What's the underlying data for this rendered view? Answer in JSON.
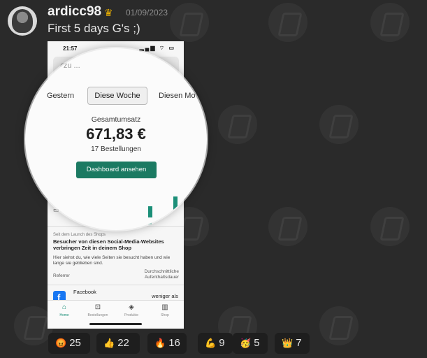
{
  "post": {
    "username": "ardicc98",
    "badge_icon": "crown-icon",
    "date": "01/09/2023",
    "message": "First 5 days G's ;)"
  },
  "screenshot": {
    "status_time": "21:57",
    "status_icons": "▂▄▆ ⌔ ▭",
    "search_fragment": "ⵔ zu ...",
    "period_tabs": [
      "Gestern",
      "Diese Woche",
      "Diesen Mo"
    ],
    "total_label": "Gesamtumsatz",
    "total_amount": "671,83 €",
    "orders": "17 Bestellungen",
    "dashboard_button": "Dashboard ansehen",
    "spark_header": "▭ 1",
    "since_launch": "Seit dem Launch des Shops",
    "card_title": "Besucher von diesen Social-Media-Websites verbringen Zeit in deinem Shop",
    "card_body": "Hier siehst du, wie viele Seiten sie besucht haben und wie lange sie geblieben sind.",
    "col_referrer": "Referrer",
    "col_duration": "Durchschnittliche Aufenthaltsdauer",
    "row_source": "Facebook",
    "row_value": "weniger als",
    "tabs": [
      {
        "label": "Home",
        "icon": "⌂"
      },
      {
        "label": "Bestellungen",
        "icon": "⊡"
      },
      {
        "label": "Produkte",
        "icon": "◈"
      },
      {
        "label": "Shop",
        "icon": "▥"
      }
    ]
  },
  "reactions": [
    {
      "emoji": "😡",
      "count": "25"
    },
    {
      "emoji": "👍",
      "count": "22"
    },
    {
      "emoji": "🔥",
      "count": "16"
    },
    {
      "emoji": "💪",
      "count": "9"
    },
    {
      "emoji": "🥳",
      "count": "5"
    },
    {
      "emoji": "👑",
      "count": "7"
    }
  ],
  "colors": {
    "background": "#2a2a2a",
    "accent_green": "#1b7a62",
    "crown": "#f0b400"
  }
}
